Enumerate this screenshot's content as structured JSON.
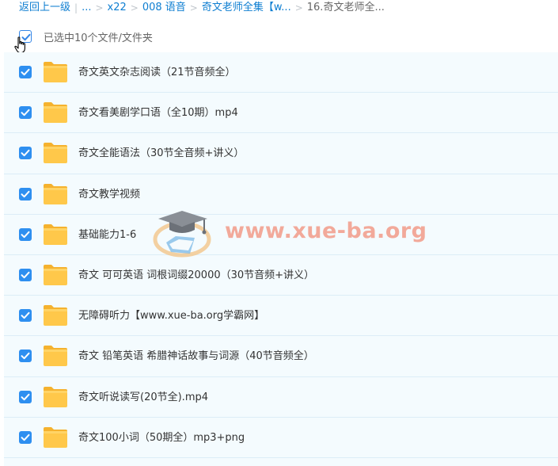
{
  "breadcrumb": {
    "back": "返回上一级",
    "ellipsis": "...",
    "items": [
      "x22",
      "008 语音",
      "奇文老师全集【w..."
    ],
    "current": "16.奇文老师全..."
  },
  "toolbar": {
    "selected_text": "已选中10个文件/文件夹"
  },
  "files": [
    {
      "name": "奇文英文杂志阅读（21节音频全）"
    },
    {
      "name": "奇文看美剧学口语（全10期）mp4"
    },
    {
      "name": "奇文全能语法（30节全音频+讲义）"
    },
    {
      "name": "奇文教学视频"
    },
    {
      "name": "基础能力1-6"
    },
    {
      "name": "奇文 可可英语 词根词缀20000（30节音频+讲义）"
    },
    {
      "name": "无障碍听力【www.xue-ba.org学霸网】"
    },
    {
      "name": "奇文 铅笔英语 希腊神话故事与词源（40节音频全）"
    },
    {
      "name": "奇文听说读写(20节全).mp4"
    },
    {
      "name": "奇文100小词（50期全）mp3+png"
    }
  ],
  "watermark": {
    "text": "www.xue-ba.org"
  },
  "colors": {
    "link": "#0e7ed1",
    "checkbox": "#2e8ff0",
    "folder": "#ffc84a",
    "row_bg": "#f4fbfe",
    "watermark": "#f2a99a"
  }
}
